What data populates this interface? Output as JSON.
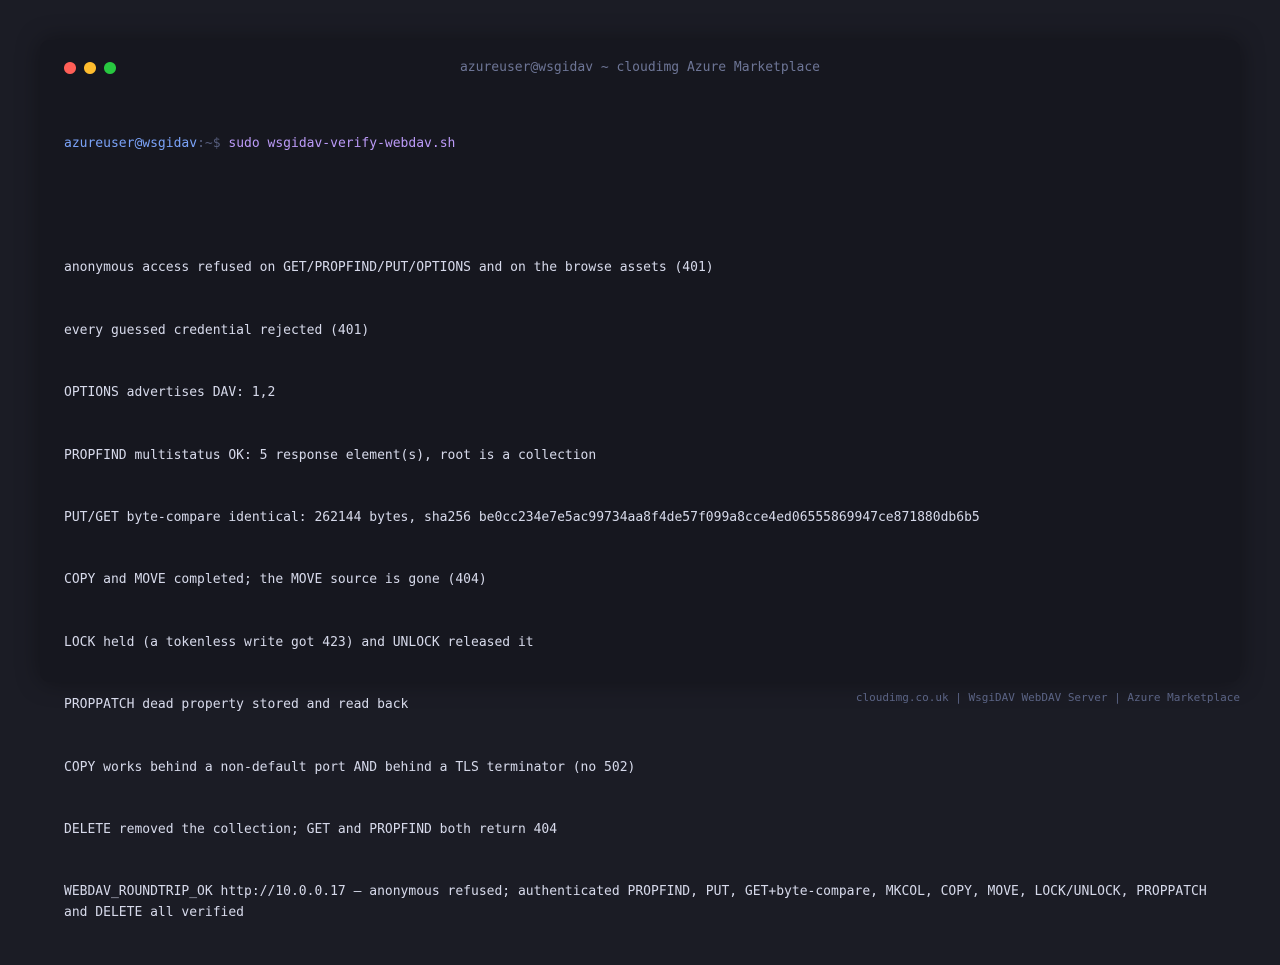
{
  "window": {
    "title": "azureuser@wsgidav ~ cloudimg Azure Marketplace"
  },
  "colors": {
    "close": "#ff5f57",
    "minimize": "#febc2e",
    "maximize": "#28c840"
  },
  "prompt": {
    "user_host": "azureuser@wsgidav",
    "path": ":~$",
    "command": "sudo wsgidav-verify-webdav.sh"
  },
  "output": [
    "anonymous access refused on GET/PROPFIND/PUT/OPTIONS and on the browse assets (401)",
    "every guessed credential rejected (401)",
    "OPTIONS advertises DAV: 1,2",
    "PROPFIND multistatus OK: 5 response element(s), root is a collection",
    "PUT/GET byte-compare identical: 262144 bytes, sha256 be0cc234e7e5ac99734aa8f4de57f099a8cce4ed06555869947ce871880db6b5",
    "COPY and MOVE completed; the MOVE source is gone (404)",
    "LOCK held (a tokenless write got 423) and UNLOCK released it",
    "PROPPATCH dead property stored and read back",
    "COPY works behind a non-default port AND behind a TLS terminator (no 502)",
    "DELETE removed the collection; GET and PROPFIND both return 404",
    "WEBDAV_ROUNDTRIP_OK http://10.0.0.17 — anonymous refused; authenticated PROPFIND, PUT, GET+byte-compare, MKCOL, COPY, MOVE, LOCK/UNLOCK, PROPPATCH and DELETE all verified"
  ],
  "footer": {
    "text": "cloudimg.co.uk | WsgiDAV WebDAV Server | Azure Marketplace"
  }
}
